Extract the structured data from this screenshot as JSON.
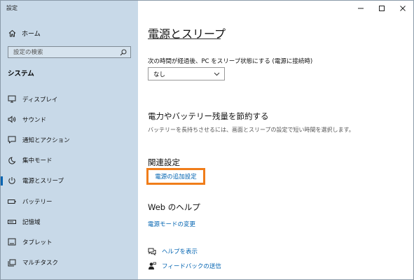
{
  "window": {
    "title": "設定"
  },
  "sidebar": {
    "home_label": "ホーム",
    "search_placeholder": "設定の検索",
    "section": "システム",
    "items": [
      {
        "label": "ディスプレイ",
        "icon": "monitor-icon"
      },
      {
        "label": "サウンド",
        "icon": "speaker-icon"
      },
      {
        "label": "通知とアクション",
        "icon": "notification-icon"
      },
      {
        "label": "集中モード",
        "icon": "moon-icon"
      },
      {
        "label": "電源とスリープ",
        "icon": "power-icon",
        "active": true
      },
      {
        "label": "バッテリー",
        "icon": "battery-icon"
      },
      {
        "label": "記憶域",
        "icon": "storage-icon"
      },
      {
        "label": "タブレット",
        "icon": "tablet-icon"
      },
      {
        "label": "マルチタスク",
        "icon": "multitask-icon"
      }
    ]
  },
  "main": {
    "title": "電源とスリープ",
    "sleep_label": "次の時間が経過後、PC をスリープ状態にする (電源に接続時)",
    "sleep_value": "なし",
    "save_heading": "電力やバッテリー残量を節約する",
    "save_desc": "バッテリーを長持ちさせるには、画面とスリープの設定で短い時間を選択します。",
    "related_heading": "関連設定",
    "related_link": "電源の追加設定",
    "web_help_heading": "Web のヘルプ",
    "web_help_link": "電源モードの変更",
    "get_help": "ヘルプを表示",
    "feedback": "フィードバックの送信"
  },
  "colors": {
    "sidebar_bg": "#c8d9e8",
    "accent": "#0063b1",
    "highlight": "#f07d1a"
  }
}
